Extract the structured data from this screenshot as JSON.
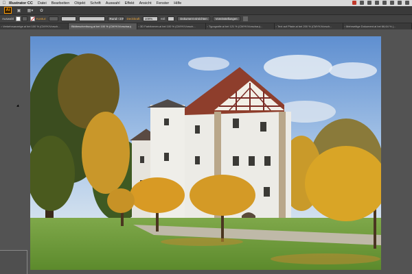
{
  "menubar": {
    "app_name": "Illustrator CC",
    "items": [
      "Datei",
      "Bearbeiten",
      "Objekt",
      "Schrift",
      "Auswahl",
      "Effekt",
      "Ansicht",
      "Fenster",
      "Hilfe"
    ]
  },
  "appbar": {
    "logo": "Ai"
  },
  "controlbar": {
    "selection_label": "Auswahl",
    "stroke_label": "Kontur:",
    "brush_value": "Rund - 3 Pt.",
    "opacity_label": "Deckkraft:",
    "opacity_value": "100%",
    "style_label": "Stil:",
    "button_document_setup": "Dokument einrichten",
    "button_preferences": "Voreinstellungen"
  },
  "tabs": [
    {
      "label": "Verkehrsanzeige.ai bei 100 % (CMYK/Vorsch...",
      "active": false
    },
    {
      "label": "Bildbeschreibung.ai bei 100 % (CMYK/Vorschau)",
      "active": true
    },
    {
      "label": "3D Farbformen.ai bei 100 % (CMYK/Vorsch...",
      "active": false
    },
    {
      "label": "Typografie.ai bei 121 % (CMYK/Vorschau)...",
      "active": false
    },
    {
      "label": "Text auf Pfade.ai bei 200 % (CMYK/Vorsch...",
      "active": false
    },
    {
      "label": "Mehrseitige Dokument.ai bei 66,64 % (...",
      "active": false
    }
  ],
  "icons": {
    "apple": "apple-icon",
    "selection_tool": "selection-arrow-icon",
    "direct_selection": "direct-selection-icon"
  },
  "colors": {
    "accent": "#ff9a00",
    "workspace": "#535353"
  }
}
